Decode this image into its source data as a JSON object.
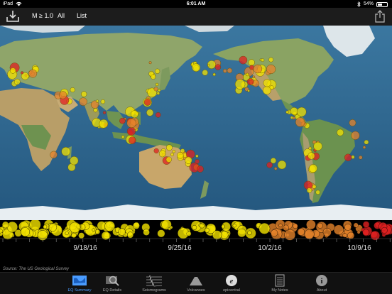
{
  "status_bar": {
    "carrier": "iPad",
    "time": "6:01 AM",
    "battery": "54%",
    "battery_level": 0.54
  },
  "toolbar": {
    "filter_label": "M ≥ 1.0",
    "all_label": "All",
    "list_label": "List"
  },
  "timeline": {
    "dates": [
      "9/18/16",
      "9/25/16",
      "10/2/16",
      "10/9/16"
    ]
  },
  "source_note": "Source: The US Geological Survey",
  "tabs": [
    {
      "label": "EQ Summary",
      "icon": "map-icon",
      "active": true
    },
    {
      "label": "EQ Details",
      "icon": "magnifier-icon",
      "active": false
    },
    {
      "label": "Seismograms",
      "icon": "seismogram-icon",
      "active": false
    },
    {
      "label": "Volcanoes",
      "icon": "volcano-icon",
      "active": false
    },
    {
      "label": "epicentral",
      "icon": "epicentral-icon",
      "active": false
    },
    {
      "label": "My Notes",
      "icon": "notes-icon",
      "active": false
    },
    {
      "label": "About",
      "icon": "info-icon",
      "active": false
    }
  ],
  "colors": {
    "ocean": "#2e6a93",
    "land": "#7d9a5e",
    "ice": "#e8eef2",
    "quake_yellow": "#f2e200",
    "quake_orange": "#e5832b",
    "quake_red": "#e02020",
    "active_tab": "#4a9cff"
  }
}
